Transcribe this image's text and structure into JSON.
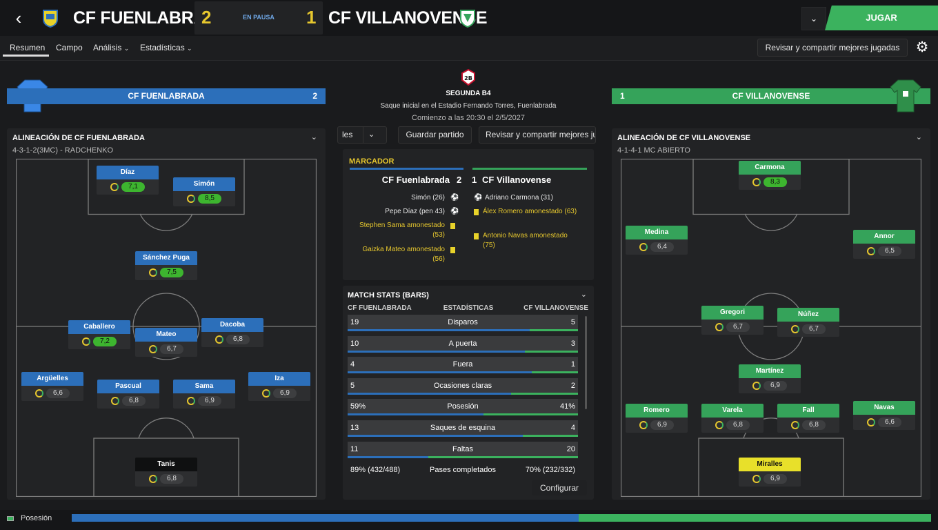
{
  "header": {
    "home_name": "CF FUENLABRADA",
    "home_score": "2",
    "status": "EN PAUSA",
    "away_score": "1",
    "away_name": "CF VILLANOVENSE",
    "play_label": "JUGAR"
  },
  "nav": {
    "tabs": [
      "Resumen",
      "Campo",
      "Análisis",
      "Estadísticas"
    ],
    "share_label": "Revisar y compartir mejores jugadas"
  },
  "banners": {
    "home_name": "CF FUENLABRADA",
    "home_score": "2",
    "away_name": "CF VILLANOVENSE",
    "away_score": "1"
  },
  "center": {
    "competition": "SEGUNDA B4",
    "kickoff": "Saque inicial en el Estadio Fernando Torres, Fuenlabrada",
    "start": "Comienzo a las 20:30 el 2/5/2027",
    "btn_partial": "les",
    "save_label": "Guardar partido",
    "share_label": "Revisar y compartir mejores ju"
  },
  "scoreboard": {
    "title": "MARCADOR",
    "home": "CF Fuenlabrada",
    "home_score": "2",
    "away_score": "1",
    "away": "CF Villanovense",
    "home_events": [
      {
        "text": "Simón (26)",
        "type": "goal"
      },
      {
        "text": "Pepe Díaz (pen 43)",
        "type": "goal"
      },
      {
        "text": "Stephen Sama amonestado (53)",
        "type": "card"
      },
      {
        "text": "Gaizka Mateo amonestado (56)",
        "type": "card"
      }
    ],
    "away_events": [
      {
        "text": "Adriano Carmona (31)",
        "type": "goal"
      },
      {
        "text": "Álex Romero amonestado (63)",
        "type": "card"
      },
      {
        "text": "Antonio Navas amonestado (75)",
        "type": "card"
      }
    ]
  },
  "stats": {
    "title": "MATCH STATS (BARS)",
    "col_home": "CF FUENLABRADA",
    "col_mid": "ESTADÍSTICAS",
    "col_away": "CF VILLANOVENSE",
    "rows": [
      {
        "home": "19",
        "label": "Disparos",
        "away": "5",
        "home_frac": 0.79
      },
      {
        "home": "10",
        "label": "A puerta",
        "away": "3",
        "home_frac": 0.77
      },
      {
        "home": "4",
        "label": "Fuera",
        "away": "1",
        "home_frac": 0.8
      },
      {
        "home": "5",
        "label": "Ocasiones claras",
        "away": "2",
        "home_frac": 0.71
      },
      {
        "home": "59%",
        "label": "Posesión",
        "away": "41%",
        "home_frac": 0.59
      },
      {
        "home": "13",
        "label": "Saques de esquina",
        "away": "4",
        "home_frac": 0.76
      },
      {
        "home": "11",
        "label": "Faltas",
        "away": "20",
        "home_frac": 0.35
      },
      {
        "home": "89% (432/488)",
        "label": "Pases completados",
        "away": "70% (232/332)",
        "home_frac": null
      }
    ],
    "configure_label": "Configurar"
  },
  "home_lineup": {
    "title": "ALINEACIÓN DE CF FUENLABRADA",
    "formation": "4-3-1-2(3MC) - RADCHENKO",
    "players": [
      {
        "name": "Díaz",
        "rating": "7,1",
        "high": true
      },
      {
        "name": "Simón",
        "rating": "8,5",
        "high": true
      },
      {
        "name": "Sánchez Puga",
        "rating": "7,5",
        "high": true
      },
      {
        "name": "Caballero",
        "rating": "7,2",
        "high": true
      },
      {
        "name": "Mateo",
        "rating": "6,7",
        "high": false
      },
      {
        "name": "Dacoba",
        "rating": "6,8",
        "high": false
      },
      {
        "name": "Argüelles",
        "rating": "6,6",
        "high": false
      },
      {
        "name": "Pascual",
        "rating": "6,8",
        "high": false
      },
      {
        "name": "Sama",
        "rating": "6,9",
        "high": false
      },
      {
        "name": "Iza",
        "rating": "6,9",
        "high": false
      },
      {
        "name": "Tanis",
        "rating": "6,8",
        "high": false
      }
    ]
  },
  "away_lineup": {
    "title": "ALINEACIÓN DE CF VILLANOVENSE",
    "formation": "4-1-4-1 MC ABIERTO",
    "players": [
      {
        "name": "Carmona",
        "rating": "8,3",
        "high": true
      },
      {
        "name": "Medina",
        "rating": "6,4",
        "high": false
      },
      {
        "name": "Annor",
        "rating": "6,5",
        "high": false
      },
      {
        "name": "Gregori",
        "rating": "6,7",
        "high": false
      },
      {
        "name": "Núñez",
        "rating": "6,7",
        "high": false
      },
      {
        "name": "Martínez",
        "rating": "6,9",
        "high": false
      },
      {
        "name": "Romero",
        "rating": "6,9",
        "high": false
      },
      {
        "name": "Varela",
        "rating": "6,8",
        "high": false
      },
      {
        "name": "Fall",
        "rating": "6,8",
        "high": false
      },
      {
        "name": "Navas",
        "rating": "6,6",
        "high": false
      },
      {
        "name": "Miralles",
        "rating": "6,9",
        "high": false
      }
    ]
  },
  "possession": {
    "label": "Posesión",
    "home_frac": 0.59
  },
  "colors": {
    "home": "#2c6fba",
    "away": "#35a35a",
    "accent": "#e6c72e",
    "play": "#3bb25e"
  }
}
